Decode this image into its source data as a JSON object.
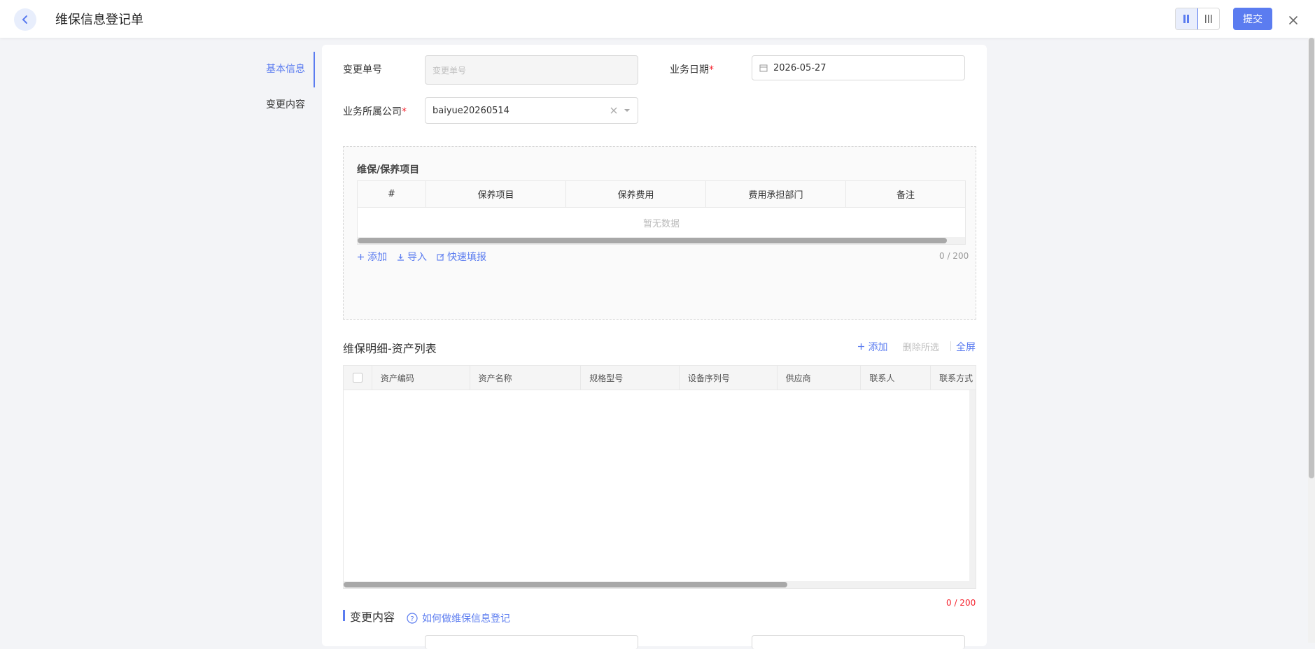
{
  "header": {
    "title": "维保信息登记单",
    "submit_label": "提交"
  },
  "leftnav": {
    "items": [
      {
        "label": "基本信息",
        "active": true
      },
      {
        "label": "变更内容",
        "active": false
      }
    ]
  },
  "form": {
    "change_no_label": "变更单号",
    "change_no_placeholder": "变更单号",
    "biz_date_label": "业务日期",
    "biz_date_value": "2026-05-27",
    "company_label": "业务所属公司",
    "company_value": "baiyue20260514",
    "required_mark": "*"
  },
  "maintenance_items": {
    "title": "维保/保养项目",
    "columns": [
      "#",
      "保养项目",
      "保养费用",
      "费用承担部门",
      "备注"
    ],
    "empty_text": "暂无数据",
    "actions": {
      "add": "添加",
      "import": "导入",
      "quick_fill": "快速填报"
    },
    "count": "0 / 200"
  },
  "asset_list": {
    "title": "维保明细-资产列表",
    "add_label": "添加",
    "delete_selected_label": "删除所选",
    "fullscreen_label": "全屏",
    "columns": [
      "资产编码",
      "资产名称",
      "规格型号",
      "设备序列号",
      "供应商",
      "联系人",
      "联系方式"
    ],
    "count": "0 / 200"
  },
  "change_content": {
    "title": "变更内容",
    "help_link": "如何做维保信息登记"
  },
  "colors": {
    "accent": "#5b7cf0",
    "danger": "#f5222d"
  }
}
